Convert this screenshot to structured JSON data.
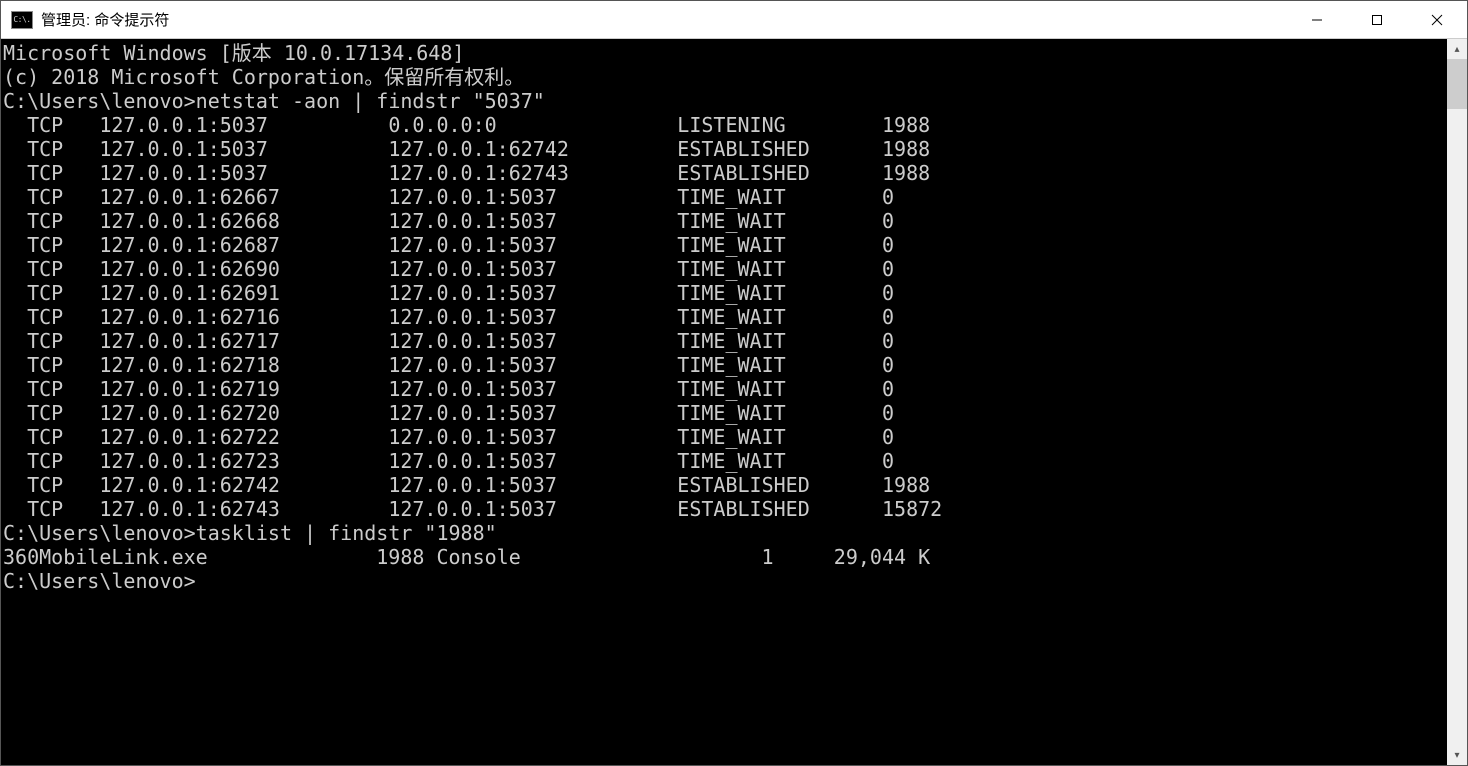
{
  "window": {
    "title": "管理员: 命令提示符",
    "icon_label": "C:\\."
  },
  "banner": {
    "line1": "Microsoft Windows [版本 10.0.17134.648]",
    "line2": "(c) 2018 Microsoft Corporation。保留所有权利。"
  },
  "prompt1": {
    "path": "C:\\Users\\lenovo>",
    "cmd": "netstat -aon | findstr \"5037\""
  },
  "netstat_rows": [
    {
      "proto": "TCP",
      "local": "127.0.0.1:5037",
      "foreign": "0.0.0.0:0",
      "state": "LISTENING",
      "pid": "1988"
    },
    {
      "proto": "TCP",
      "local": "127.0.0.1:5037",
      "foreign": "127.0.0.1:62742",
      "state": "ESTABLISHED",
      "pid": "1988"
    },
    {
      "proto": "TCP",
      "local": "127.0.0.1:5037",
      "foreign": "127.0.0.1:62743",
      "state": "ESTABLISHED",
      "pid": "1988"
    },
    {
      "proto": "TCP",
      "local": "127.0.0.1:62667",
      "foreign": "127.0.0.1:5037",
      "state": "TIME_WAIT",
      "pid": "0"
    },
    {
      "proto": "TCP",
      "local": "127.0.0.1:62668",
      "foreign": "127.0.0.1:5037",
      "state": "TIME_WAIT",
      "pid": "0"
    },
    {
      "proto": "TCP",
      "local": "127.0.0.1:62687",
      "foreign": "127.0.0.1:5037",
      "state": "TIME_WAIT",
      "pid": "0"
    },
    {
      "proto": "TCP",
      "local": "127.0.0.1:62690",
      "foreign": "127.0.0.1:5037",
      "state": "TIME_WAIT",
      "pid": "0"
    },
    {
      "proto": "TCP",
      "local": "127.0.0.1:62691",
      "foreign": "127.0.0.1:5037",
      "state": "TIME_WAIT",
      "pid": "0"
    },
    {
      "proto": "TCP",
      "local": "127.0.0.1:62716",
      "foreign": "127.0.0.1:5037",
      "state": "TIME_WAIT",
      "pid": "0"
    },
    {
      "proto": "TCP",
      "local": "127.0.0.1:62717",
      "foreign": "127.0.0.1:5037",
      "state": "TIME_WAIT",
      "pid": "0"
    },
    {
      "proto": "TCP",
      "local": "127.0.0.1:62718",
      "foreign": "127.0.0.1:5037",
      "state": "TIME_WAIT",
      "pid": "0"
    },
    {
      "proto": "TCP",
      "local": "127.0.0.1:62719",
      "foreign": "127.0.0.1:5037",
      "state": "TIME_WAIT",
      "pid": "0"
    },
    {
      "proto": "TCP",
      "local": "127.0.0.1:62720",
      "foreign": "127.0.0.1:5037",
      "state": "TIME_WAIT",
      "pid": "0"
    },
    {
      "proto": "TCP",
      "local": "127.0.0.1:62722",
      "foreign": "127.0.0.1:5037",
      "state": "TIME_WAIT",
      "pid": "0"
    },
    {
      "proto": "TCP",
      "local": "127.0.0.1:62723",
      "foreign": "127.0.0.1:5037",
      "state": "TIME_WAIT",
      "pid": "0"
    },
    {
      "proto": "TCP",
      "local": "127.0.0.1:62742",
      "foreign": "127.0.0.1:5037",
      "state": "ESTABLISHED",
      "pid": "1988"
    },
    {
      "proto": "TCP",
      "local": "127.0.0.1:62743",
      "foreign": "127.0.0.1:5037",
      "state": "ESTABLISHED",
      "pid": "15872"
    }
  ],
  "prompt2": {
    "path": "C:\\Users\\lenovo>",
    "cmd": "tasklist | findstr \"1988\""
  },
  "tasklist_rows": [
    {
      "name": "360MobileLink.exe",
      "pid": "1988",
      "session": "Console",
      "snum": "1",
      "mem": "29,044 K"
    }
  ],
  "prompt3": {
    "path": "C:\\Users\\lenovo>"
  }
}
